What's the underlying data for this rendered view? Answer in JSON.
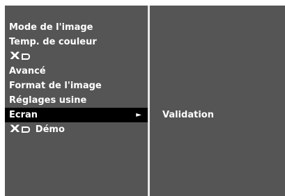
{
  "menu": {
    "items": [
      {
        "label": "Mode de l'image"
      },
      {
        "label": "Temp. de couleur"
      },
      {
        "logo": "XD",
        "icon": "xd-logo-icon"
      },
      {
        "label": "Avancé"
      },
      {
        "label": "Format de l'image"
      },
      {
        "label": "Réglages usine"
      },
      {
        "label": "Ecran",
        "selected": true,
        "arrow": "►"
      },
      {
        "logo": "XD",
        "label": "Démo",
        "icon": "xd-logo-icon"
      }
    ]
  },
  "submenu": {
    "items": [
      {
        "label": "Validation"
      }
    ]
  },
  "colors": {
    "panel_background": "#555555",
    "selected_background": "#000000",
    "divider": "#e6e6e6",
    "text": "#ffffff"
  }
}
